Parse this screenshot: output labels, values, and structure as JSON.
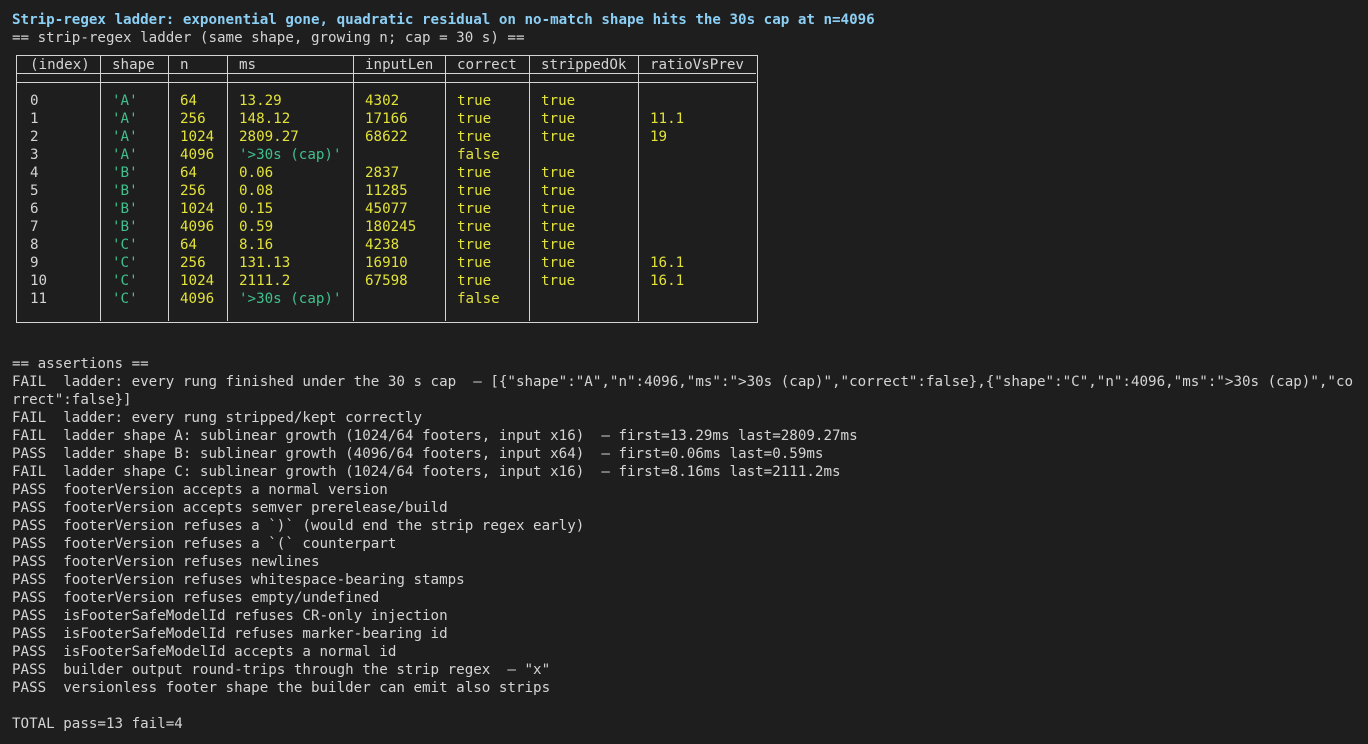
{
  "title": "Strip-regex ladder: exponential gone, quadratic residual on no-match shape hits the 30s cap at n=4096",
  "subtitle": "== strip-regex ladder (same shape, growing n; cap = 30 s) ==",
  "table": {
    "headers": [
      "(index)",
      "shape",
      "n",
      "ms",
      "inputLen",
      "correct",
      "strippedOk",
      "ratioVsPrev"
    ],
    "rows": [
      [
        "0",
        "'A'",
        "64",
        "13.29",
        "4302",
        "true",
        "true",
        ""
      ],
      [
        "1",
        "'A'",
        "256",
        "148.12",
        "17166",
        "true",
        "true",
        "11.1"
      ],
      [
        "2",
        "'A'",
        "1024",
        "2809.27",
        "68622",
        "true",
        "true",
        "19"
      ],
      [
        "3",
        "'A'",
        "4096",
        "'>30s (cap)'",
        "",
        "false",
        "",
        ""
      ],
      [
        "4",
        "'B'",
        "64",
        "0.06",
        "2837",
        "true",
        "true",
        ""
      ],
      [
        "5",
        "'B'",
        "256",
        "0.08",
        "11285",
        "true",
        "true",
        ""
      ],
      [
        "6",
        "'B'",
        "1024",
        "0.15",
        "45077",
        "true",
        "true",
        ""
      ],
      [
        "7",
        "'B'",
        "4096",
        "0.59",
        "180245",
        "true",
        "true",
        ""
      ],
      [
        "8",
        "'C'",
        "64",
        "8.16",
        "4238",
        "true",
        "true",
        ""
      ],
      [
        "9",
        "'C'",
        "256",
        "131.13",
        "16910",
        "true",
        "true",
        "16.1"
      ],
      [
        "10",
        "'C'",
        "1024",
        "2111.2",
        "67598",
        "true",
        "true",
        "16.1"
      ],
      [
        "11",
        "'C'",
        "4096",
        "'>30s (cap)'",
        "",
        "false",
        "",
        ""
      ]
    ]
  },
  "assertions_header": "== assertions ==",
  "assertion_first": "FAIL  ladder: every rung finished under the 30 s cap  — [{\"shape\":\"A\",\"n\":4096,\"ms\":\">30s (cap)\",\"correct\":false},{\"shape\":\"C\",\"n\":4096,\"ms\":\">30s (cap)\",\"correct\":false}]",
  "assertions": [
    "FAIL  ladder: every rung stripped/kept correctly",
    "FAIL  ladder shape A: sublinear growth (1024/64 footers, input x16)  — first=13.29ms last=2809.27ms",
    "PASS  ladder shape B: sublinear growth (4096/64 footers, input x64)  — first=0.06ms last=0.59ms",
    "FAIL  ladder shape C: sublinear growth (1024/64 footers, input x16)  — first=8.16ms last=2111.2ms",
    "PASS  footerVersion accepts a normal version",
    "PASS  footerVersion accepts semver prerelease/build",
    "PASS  footerVersion refuses a `)` (would end the strip regex early)",
    "PASS  footerVersion refuses a `(` counterpart",
    "PASS  footerVersion refuses newlines",
    "PASS  footerVersion refuses whitespace-bearing stamps",
    "PASS  footerVersion refuses empty/undefined",
    "PASS  isFooterSafeModelId refuses CR-only injection",
    "PASS  isFooterSafeModelId refuses marker-bearing id",
    "PASS  isFooterSafeModelId accepts a normal id",
    "PASS  builder output round-trips through the strip regex  — \"x\"",
    "PASS  versionless footer shape the builder can emit also strips"
  ],
  "total": "TOTAL pass=13 fail=4",
  "colors": {
    "background": "#1e1e1e",
    "title": "#8ccff5",
    "string": "#3fc08c",
    "number": "#e2e23a",
    "text": "#d4d4d4"
  }
}
